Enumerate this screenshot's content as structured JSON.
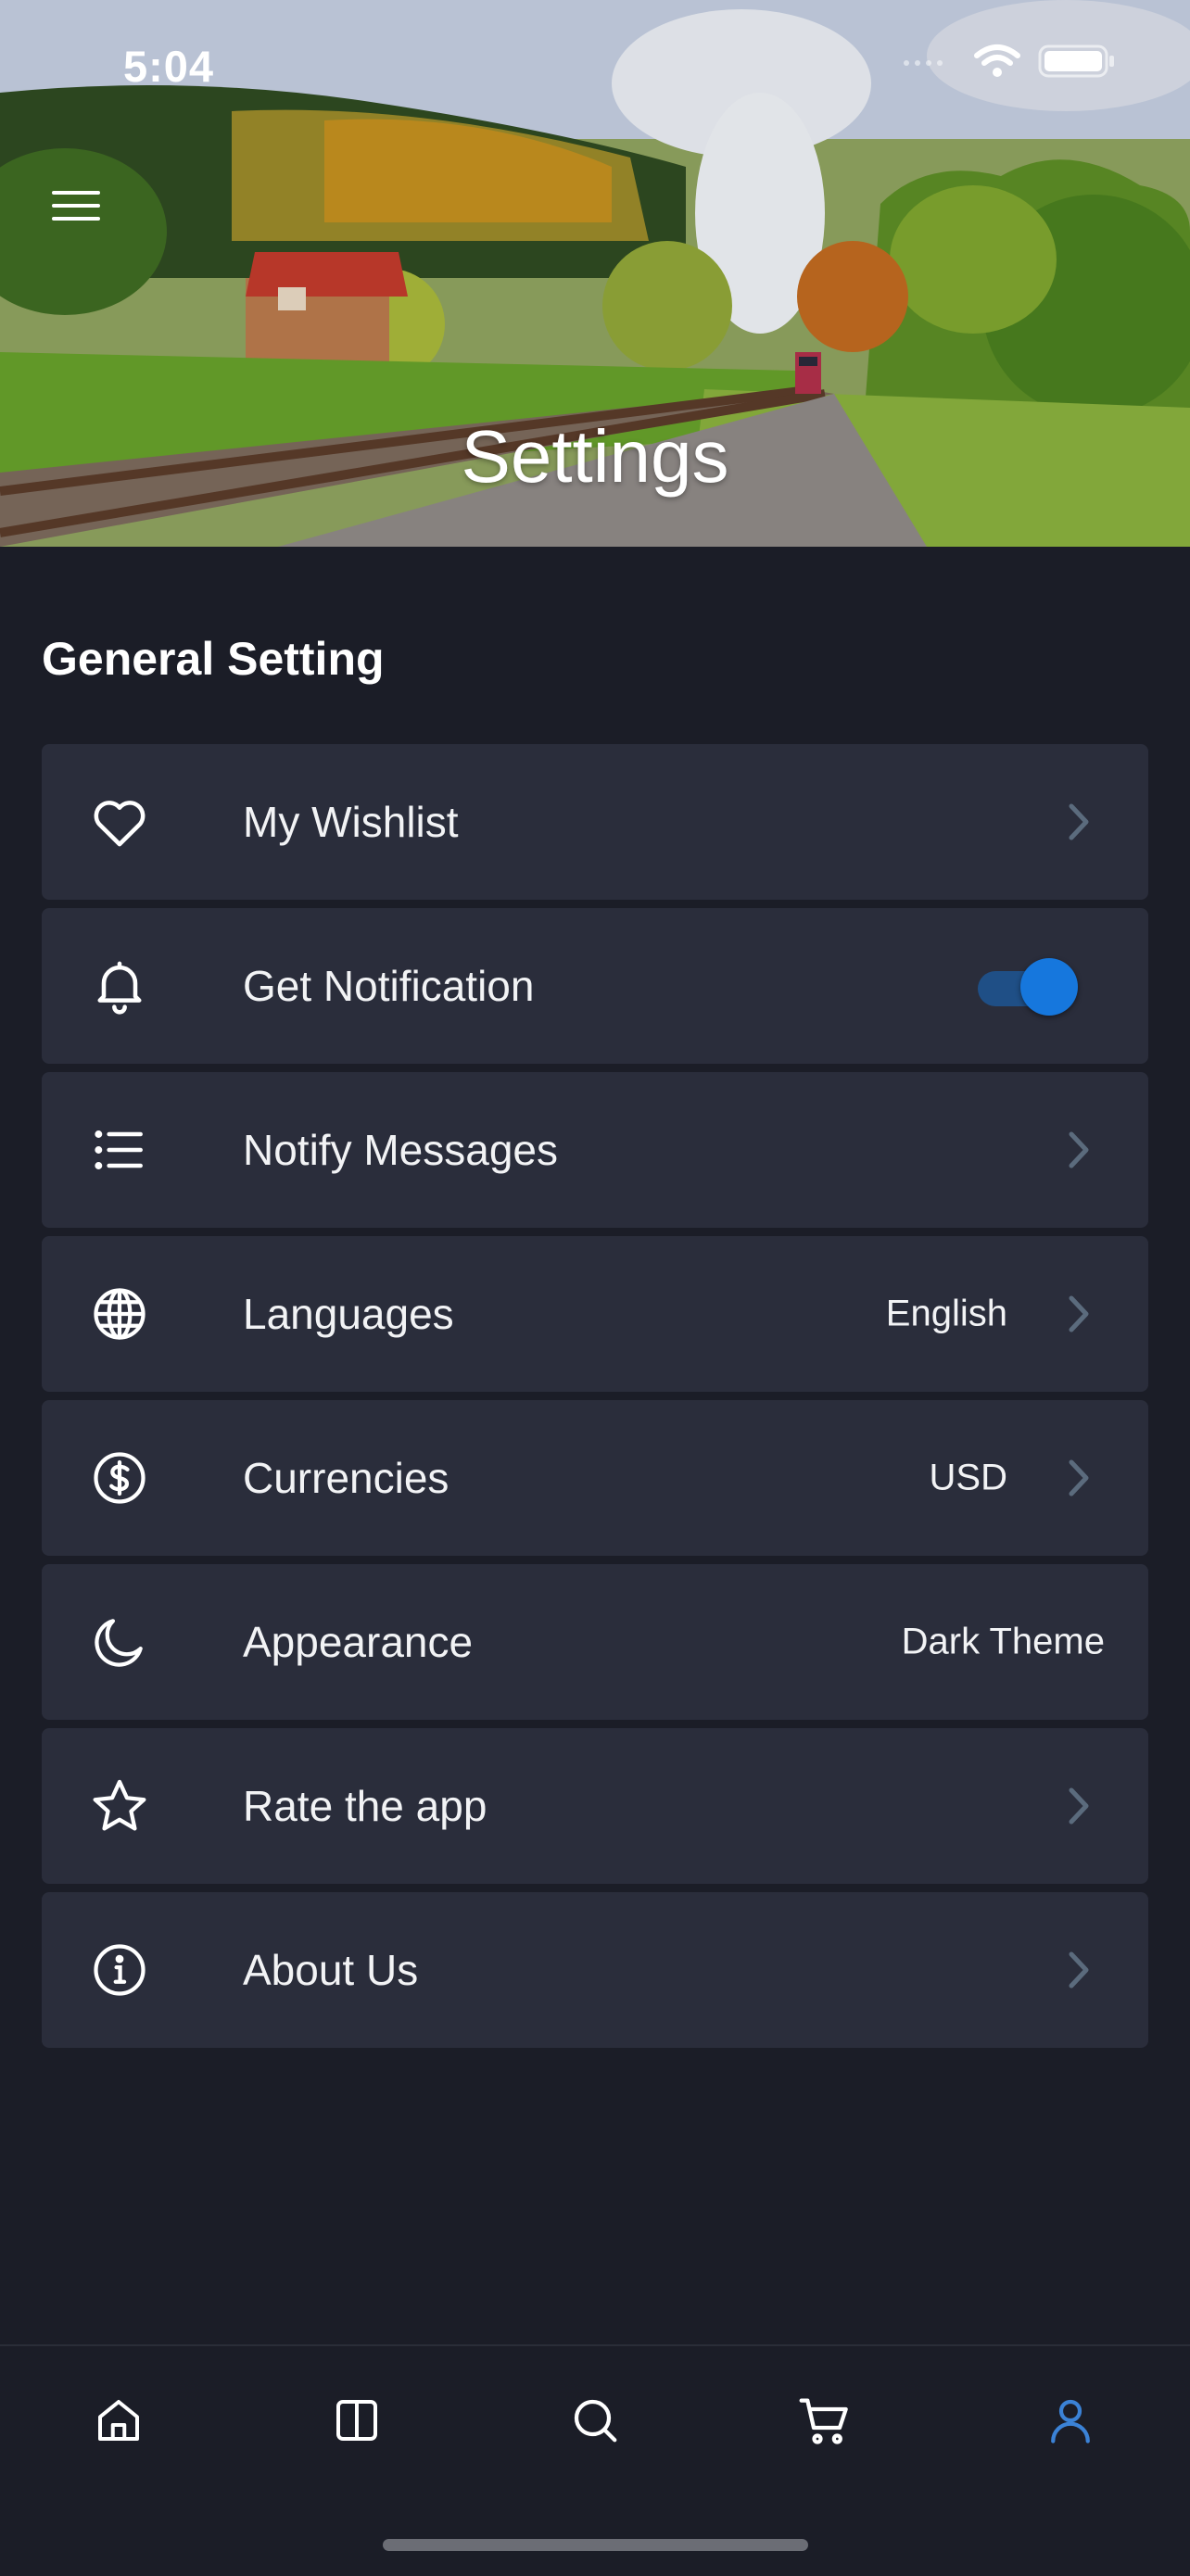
{
  "status_bar": {
    "time": "5:04"
  },
  "header": {
    "title": "Settings",
    "menu_icon": "hamburger-menu-icon"
  },
  "section": {
    "title": "General Setting"
  },
  "settings": [
    {
      "label": "My Wishlist",
      "icon": "heart-icon",
      "value": "",
      "chevron": true
    },
    {
      "label": "Get Notification",
      "icon": "bell-icon",
      "toggle": true,
      "toggle_on": true
    },
    {
      "label": "Notify Messages",
      "icon": "list-icon",
      "value": "",
      "chevron": true
    },
    {
      "label": "Languages",
      "icon": "globe-icon",
      "value": "English",
      "chevron": true
    },
    {
      "label": "Currencies",
      "icon": "dollar-circle-icon",
      "value": "USD",
      "chevron": true
    },
    {
      "label": "Appearance",
      "icon": "moon-icon",
      "value": "Dark Theme",
      "chevron": false
    },
    {
      "label": "Rate the app",
      "icon": "star-icon",
      "value": "",
      "chevron": true
    },
    {
      "label": "About Us",
      "icon": "info-circle-icon",
      "value": "",
      "chevron": true
    }
  ],
  "tabbar": {
    "items": [
      {
        "name": "home",
        "icon": "home-icon",
        "active": false
      },
      {
        "name": "categories",
        "icon": "columns-icon",
        "active": false
      },
      {
        "name": "search",
        "icon": "search-icon",
        "active": false
      },
      {
        "name": "cart",
        "icon": "cart-icon",
        "active": false
      },
      {
        "name": "profile",
        "icon": "user-icon",
        "active": true
      }
    ]
  },
  "colors": {
    "background": "#1b1d27",
    "card": "#2a2d3b",
    "accent": "#1677dd",
    "chevron": "#5b6b7d",
    "active_tab": "#3b82d6"
  }
}
